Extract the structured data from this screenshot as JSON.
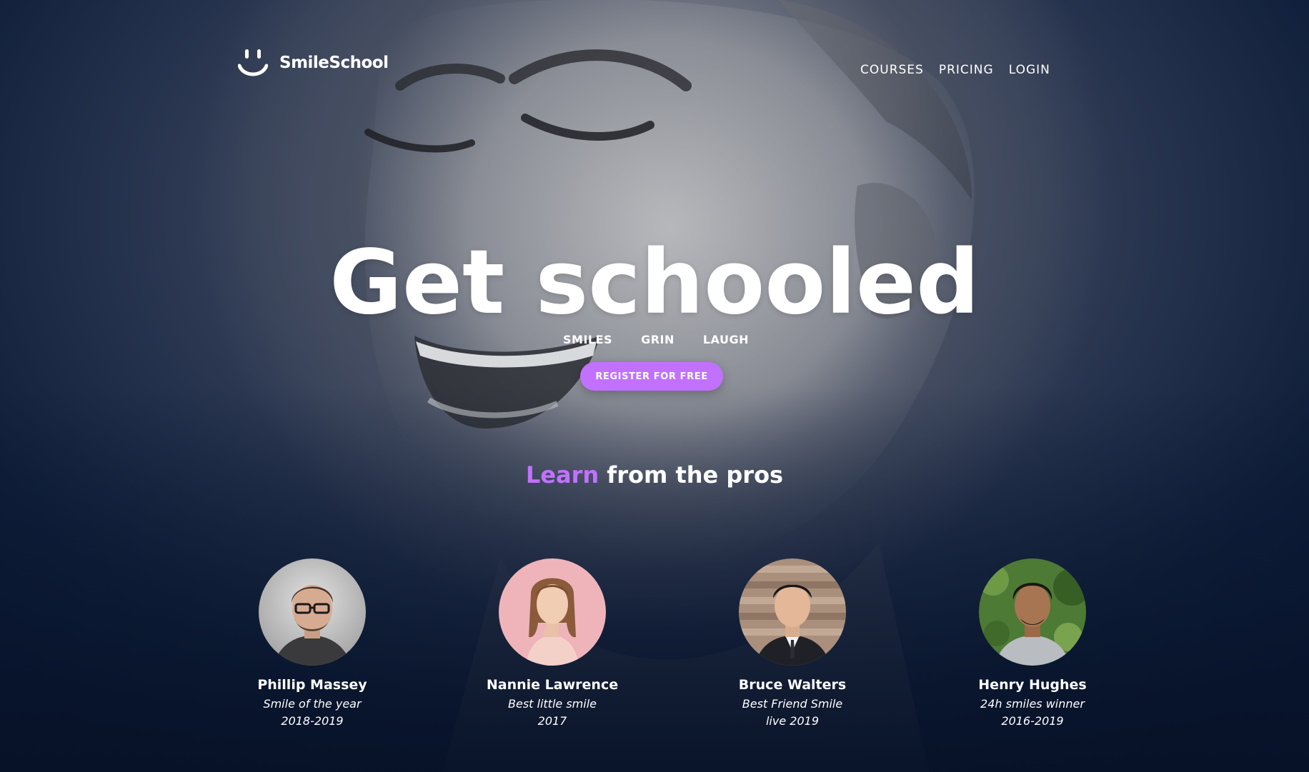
{
  "brand": {
    "name": "SmileSchool",
    "logo_icon": "smile-icon"
  },
  "nav": {
    "items": [
      {
        "label": "COURSES"
      },
      {
        "label": "PRICING"
      },
      {
        "label": "LOGIN"
      }
    ]
  },
  "hero": {
    "headline": "Get schooled",
    "tags": [
      "SMILES",
      "GRIN",
      "LAUGH"
    ],
    "cta_label": "REGISTER FOR FREE"
  },
  "pros_section": {
    "title_accent": "Learn",
    "title_rest": " from the pros",
    "people": [
      {
        "name": "Phillip Massey",
        "title": "Smile of the year",
        "years": "2018-2019"
      },
      {
        "name": "Nannie Lawrence",
        "title": "Best little smile",
        "years": "2017"
      },
      {
        "name": "Bruce Walters",
        "title": "Best Friend Smile",
        "years": "live 2019"
      },
      {
        "name": "Henry Hughes",
        "title": "24h smiles winner",
        "years": "2016-2019"
      }
    ]
  },
  "colors": {
    "accent": "#c271ff",
    "background_dark": "#0c1a33",
    "text": "#ffffff"
  }
}
